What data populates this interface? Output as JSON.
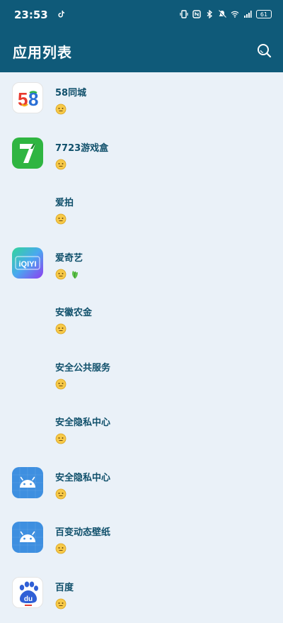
{
  "status_bar": {
    "time": "23:53",
    "battery": "61"
  },
  "app_bar": {
    "title": "应用列表"
  },
  "apps": [
    {
      "name": "58同城",
      "icon": "app-58-icon",
      "status_icons": [
        "smile-face-icon"
      ]
    },
    {
      "name": "7723游戏盒",
      "icon": "app-7723-icon",
      "status_icons": [
        "smile-face-icon"
      ]
    },
    {
      "name": "爱拍",
      "icon": "none",
      "status_icons": [
        "smile-face-icon"
      ]
    },
    {
      "name": "爱奇艺",
      "icon": "app-iqiyi-icon",
      "status_icons": [
        "smile-face-icon",
        "leaf-icon"
      ]
    },
    {
      "name": "安徽农金",
      "icon": "none",
      "status_icons": [
        "smile-face-icon"
      ]
    },
    {
      "name": "安全公共服务",
      "icon": "none",
      "status_icons": [
        "smile-face-icon"
      ]
    },
    {
      "name": "安全隐私中心",
      "icon": "none",
      "status_icons": [
        "smile-face-icon"
      ]
    },
    {
      "name": "安全隐私中心",
      "icon": "android-robot-icon",
      "status_icons": [
        "smile-face-icon"
      ]
    },
    {
      "name": "百变动态壁纸",
      "icon": "android-robot-icon",
      "status_icons": [
        "smile-face-icon"
      ]
    },
    {
      "name": "百度",
      "icon": "baidu-paw-icon",
      "status_icons": [
        "smile-face-icon"
      ]
    }
  ],
  "icon_labels": {
    "iqiyi": "iQIYI",
    "baidu": "du",
    "seven": "7"
  },
  "colors": {
    "header": "#0f5a79",
    "background": "#eaf1f8",
    "app_name": "#10506b"
  }
}
